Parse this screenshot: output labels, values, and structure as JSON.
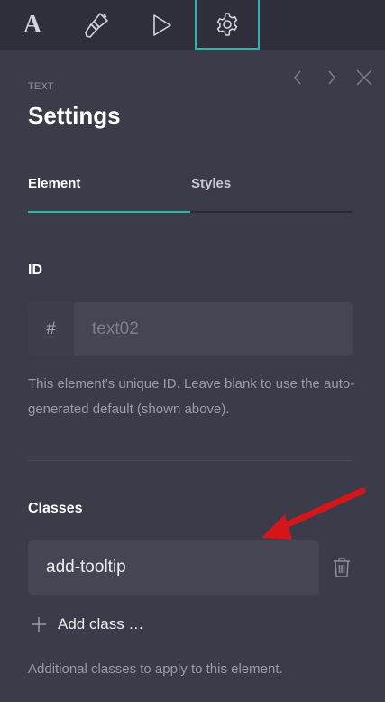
{
  "toolbar": {
    "buttons": [
      {
        "name": "typography",
        "icon": "letter-a-icon",
        "glyph": "A"
      },
      {
        "name": "design",
        "icon": "paintbrush-icon"
      },
      {
        "name": "interactions",
        "icon": "play-icon"
      },
      {
        "name": "settings",
        "icon": "gear-icon",
        "active": true
      }
    ]
  },
  "nav": {
    "prev_icon": "chevron-left-icon",
    "next_icon": "chevron-right-icon",
    "close_icon": "close-icon"
  },
  "header": {
    "eyebrow": "TEXT",
    "title": "Settings"
  },
  "tabs": [
    {
      "label": "Element",
      "active": true
    },
    {
      "label": "Styles",
      "active": false
    }
  ],
  "id_section": {
    "label": "ID",
    "prefix": "#",
    "value": "",
    "placeholder": "text02",
    "help": "This element's unique ID. Leave blank to use the auto-generated default (shown above)."
  },
  "classes_section": {
    "label": "Classes",
    "items": [
      {
        "name": "add-tooltip"
      }
    ],
    "add_label": "Add class …",
    "help": "Additional classes to apply to this element."
  },
  "colors": {
    "accent": "#2bb5ad",
    "panel": "#3b3b49",
    "topbar": "#2f2f3b",
    "annotation_arrow": "#d3161a"
  }
}
